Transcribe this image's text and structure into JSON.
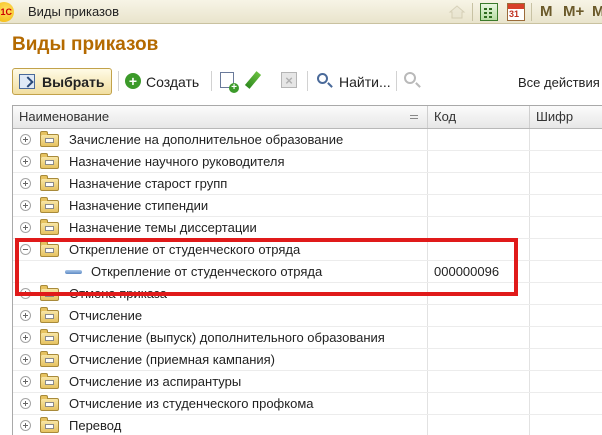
{
  "window": {
    "title": "Виды приказов",
    "logo": "1С"
  },
  "titlebar_tools": [
    {
      "icon": "home-icon"
    },
    {
      "icon": "calculator-icon"
    },
    {
      "icon": "calendar-icon",
      "text": "31"
    },
    {
      "text": "M"
    },
    {
      "text": "M+"
    },
    {
      "text": "M-"
    }
  ],
  "page": {
    "title": "Виды приказов"
  },
  "toolbar": {
    "select_label": "Выбрать",
    "create_label": "Создать",
    "find_label": "Найти...",
    "all_actions_label": "Все действия"
  },
  "grid": {
    "columns": [
      "Наименование",
      "Код",
      "Шифр"
    ],
    "rows": [
      {
        "name": "Зачисление на дополнительное образование",
        "code": "",
        "cipher": "",
        "kind": "group",
        "expanded": false
      },
      {
        "name": "Назначение научного руководителя",
        "code": "",
        "cipher": "",
        "kind": "group",
        "expanded": false
      },
      {
        "name": "Назначение старост групп",
        "code": "",
        "cipher": "",
        "kind": "group",
        "expanded": false
      },
      {
        "name": "Назначение стипендии",
        "code": "",
        "cipher": "",
        "kind": "group",
        "expanded": false
      },
      {
        "name": "Назначение темы диссертации",
        "code": "",
        "cipher": "",
        "kind": "group",
        "expanded": false
      },
      {
        "name": "Открепление от студенческого отряда",
        "code": "",
        "cipher": "",
        "kind": "group",
        "expanded": true
      },
      {
        "name": "Открепление от студенческого отряда",
        "code": "000000096",
        "cipher": "",
        "kind": "item"
      },
      {
        "name": "Отмена приказа",
        "code": "",
        "cipher": "",
        "kind": "group",
        "expanded": false
      },
      {
        "name": "Отчисление",
        "code": "",
        "cipher": "",
        "kind": "group",
        "expanded": false
      },
      {
        "name": "Отчисление (выпуск) дополнительного образования",
        "code": "",
        "cipher": "",
        "kind": "group",
        "expanded": false
      },
      {
        "name": "Отчисление (приемная кампания)",
        "code": "",
        "cipher": "",
        "kind": "group",
        "expanded": false
      },
      {
        "name": "Отчисление из аспирантуры",
        "code": "",
        "cipher": "",
        "kind": "group",
        "expanded": false
      },
      {
        "name": "Отчисление из студенческого профкома",
        "code": "",
        "cipher": "",
        "kind": "group",
        "expanded": false
      },
      {
        "name": "Перевод",
        "code": "",
        "cipher": "",
        "kind": "group",
        "expanded": false
      }
    ]
  },
  "colors": {
    "page_title": "#b46a00",
    "highlight_box": "#e01a1a"
  }
}
